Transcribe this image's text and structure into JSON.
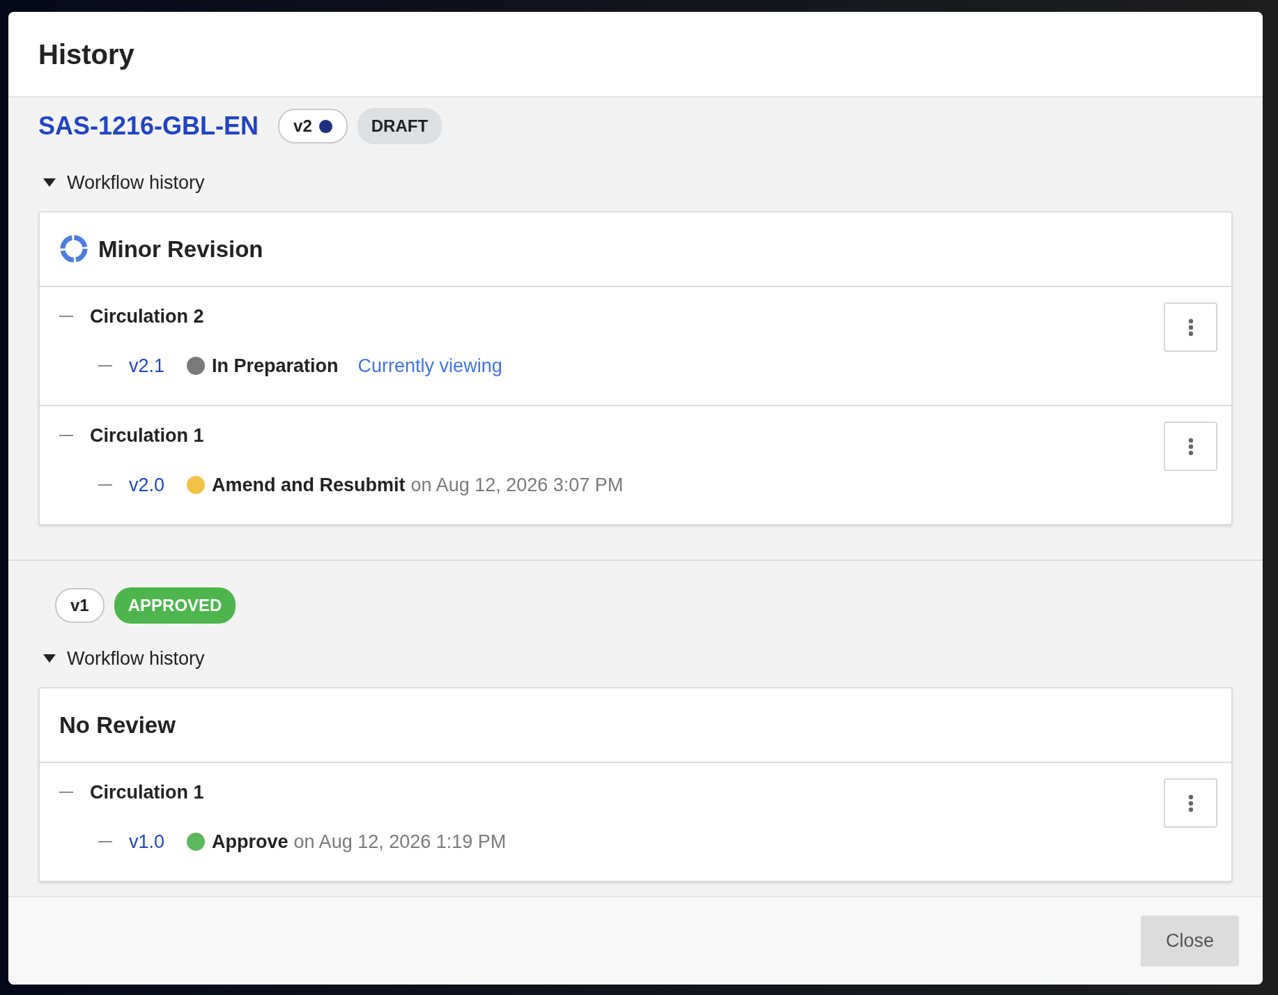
{
  "modal": {
    "title": "History"
  },
  "versions": [
    {
      "document_id": "SAS-1216-GBL-EN",
      "version": "v2",
      "current": true,
      "status": {
        "label": "DRAFT",
        "kind": "draft"
      },
      "workflow_toggle": {
        "label": "Workflow history",
        "expanded": true
      },
      "workflow": {
        "name": "Minor Revision",
        "in_progress": true,
        "circulations": [
          {
            "title": "Circulation 2",
            "entries": [
              {
                "version": "v2.1",
                "color": "#7a7a7a",
                "status": "In Preparation",
                "note": "Currently viewing"
              }
            ]
          },
          {
            "title": "Circulation 1",
            "entries": [
              {
                "version": "v2.0",
                "color": "#f2c244",
                "status": "Amend and Resubmit",
                "date": "on Aug 12, 2026 3:07 PM"
              }
            ]
          }
        ]
      }
    },
    {
      "version": "v1",
      "current": false,
      "status": {
        "label": "APPROVED",
        "kind": "approved"
      },
      "workflow_toggle": {
        "label": "Workflow history",
        "expanded": true
      },
      "workflow": {
        "name": "No Review",
        "in_progress": false,
        "circulations": [
          {
            "title": "Circulation 1",
            "entries": [
              {
                "version": "v1.0",
                "color": "#5cb85c",
                "status": "Approve",
                "date": "on Aug 12, 2026 1:19 PM"
              }
            ]
          }
        ]
      }
    }
  ],
  "close_button": "Close"
}
